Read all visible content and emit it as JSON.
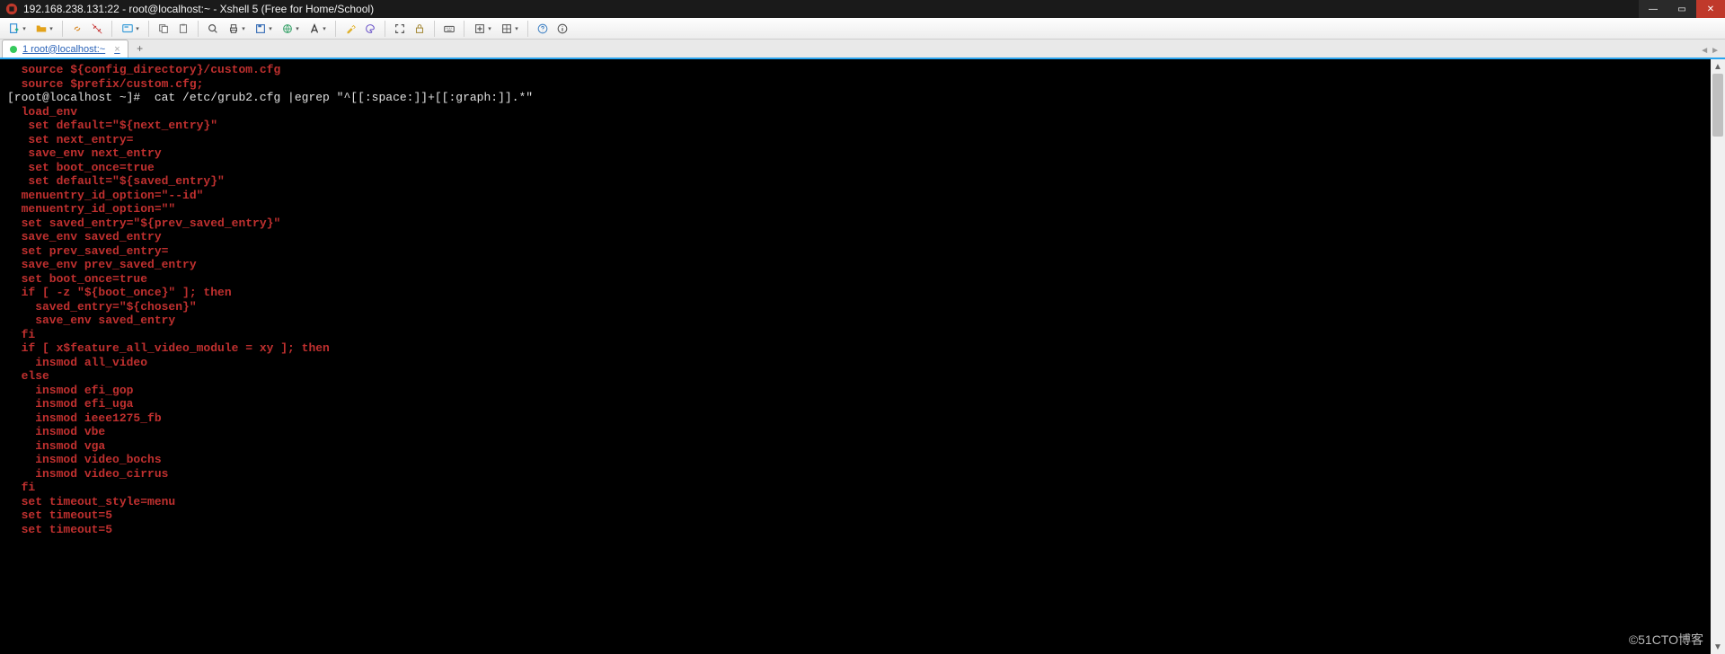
{
  "window": {
    "title": "192.168.238.131:22 - root@localhost:~ - Xshell 5 (Free for Home/School)",
    "min_icon": "—",
    "max_icon": "▭",
    "close_icon": "✕"
  },
  "toolbar": {
    "icons": [
      {
        "name": "new-session-icon",
        "glyph": "document-plus",
        "dd": true,
        "color": "#2a8ad4"
      },
      {
        "name": "open-folder-icon",
        "glyph": "folder",
        "dd": true,
        "color": "#e3a21a"
      },
      {
        "name": "link-icon",
        "glyph": "link",
        "color": "#d98c2b"
      },
      {
        "name": "disconnect-icon",
        "glyph": "broken-link",
        "color": "#c34b4b"
      },
      {
        "name": "properties-icon",
        "glyph": "card",
        "dd": true,
        "color": "#3a9dd9"
      },
      {
        "name": "copy-icon",
        "glyph": "copy",
        "color": "#777"
      },
      {
        "name": "paste-icon",
        "glyph": "paste",
        "color": "#777"
      },
      {
        "name": "find-icon",
        "glyph": "search",
        "color": "#555"
      },
      {
        "name": "print-icon",
        "glyph": "printer",
        "dd": true,
        "color": "#555"
      },
      {
        "name": "save-icon",
        "glyph": "save",
        "dd": true,
        "color": "#3a6fb7"
      },
      {
        "name": "globe-icon",
        "glyph": "globe",
        "dd": true,
        "color": "#3aa36b"
      },
      {
        "name": "font-icon",
        "glyph": "font",
        "dd": true,
        "color": "#333"
      },
      {
        "name": "highlight-icon",
        "glyph": "highlight",
        "color": "#e0b12a"
      },
      {
        "name": "palette-icon",
        "glyph": "palette",
        "color": "#6b54c9"
      },
      {
        "name": "fullscreen-icon",
        "glyph": "fullscreen",
        "color": "#555"
      },
      {
        "name": "lock-icon",
        "glyph": "lock",
        "color": "#a68b3b"
      },
      {
        "name": "keyboard-icon",
        "glyph": "keyboard",
        "color": "#555"
      },
      {
        "name": "add-panel-icon",
        "glyph": "plus-box",
        "dd": true,
        "color": "#555"
      },
      {
        "name": "layout-icon",
        "glyph": "layout",
        "dd": true,
        "color": "#555"
      },
      {
        "name": "help-icon",
        "glyph": "help",
        "color": "#4a88c7"
      },
      {
        "name": "info-icon",
        "glyph": "info",
        "color": "#555"
      }
    ]
  },
  "tabs": {
    "items": [
      {
        "label": "1 root@localhost:~",
        "active": true
      }
    ],
    "add_label": "+",
    "nav_left": "◄",
    "nav_right": "►"
  },
  "terminal": {
    "lines": [
      {
        "cls": "hl",
        "text": "  source ${config_directory}/custom.cfg"
      },
      {
        "cls": "hl",
        "text": "  source $prefix/custom.cfg;"
      },
      {
        "cls": "prompt",
        "text": "[root@localhost ~]#  cat /etc/grub2.cfg |egrep \"^[[:space:]]+[[:graph:]].*\""
      },
      {
        "cls": "hl",
        "text": "  load_env"
      },
      {
        "cls": "hl",
        "text": "   set default=\"${next_entry}\""
      },
      {
        "cls": "hl",
        "text": "   set next_entry="
      },
      {
        "cls": "hl",
        "text": "   save_env next_entry"
      },
      {
        "cls": "hl",
        "text": "   set boot_once=true"
      },
      {
        "cls": "hl",
        "text": "   set default=\"${saved_entry}\""
      },
      {
        "cls": "hl",
        "text": "  menuentry_id_option=\"--id\""
      },
      {
        "cls": "hl",
        "text": "  menuentry_id_option=\"\""
      },
      {
        "cls": "hl",
        "text": "  set saved_entry=\"${prev_saved_entry}\""
      },
      {
        "cls": "hl",
        "text": "  save_env saved_entry"
      },
      {
        "cls": "hl",
        "text": "  set prev_saved_entry="
      },
      {
        "cls": "hl",
        "text": "  save_env prev_saved_entry"
      },
      {
        "cls": "hl",
        "text": "  set boot_once=true"
      },
      {
        "cls": "hl",
        "text": "  if [ -z \"${boot_once}\" ]; then"
      },
      {
        "cls": "hl",
        "text": "    saved_entry=\"${chosen}\""
      },
      {
        "cls": "hl",
        "text": "    save_env saved_entry"
      },
      {
        "cls": "hl",
        "text": "  fi"
      },
      {
        "cls": "hl",
        "text": "  if [ x$feature_all_video_module = xy ]; then"
      },
      {
        "cls": "hl",
        "text": "    insmod all_video"
      },
      {
        "cls": "hl",
        "text": "  else"
      },
      {
        "cls": "hl",
        "text": "    insmod efi_gop"
      },
      {
        "cls": "hl",
        "text": "    insmod efi_uga"
      },
      {
        "cls": "hl",
        "text": "    insmod ieee1275_fb"
      },
      {
        "cls": "hl",
        "text": "    insmod vbe"
      },
      {
        "cls": "hl",
        "text": "    insmod vga"
      },
      {
        "cls": "hl",
        "text": "    insmod video_bochs"
      },
      {
        "cls": "hl",
        "text": "    insmod video_cirrus"
      },
      {
        "cls": "hl",
        "text": "  fi"
      },
      {
        "cls": "hl",
        "text": "  set timeout_style=menu"
      },
      {
        "cls": "hl",
        "text": "  set timeout=5"
      },
      {
        "cls": "hl",
        "text": "  set timeout=5"
      }
    ]
  },
  "watermark": "©51CTO博客"
}
